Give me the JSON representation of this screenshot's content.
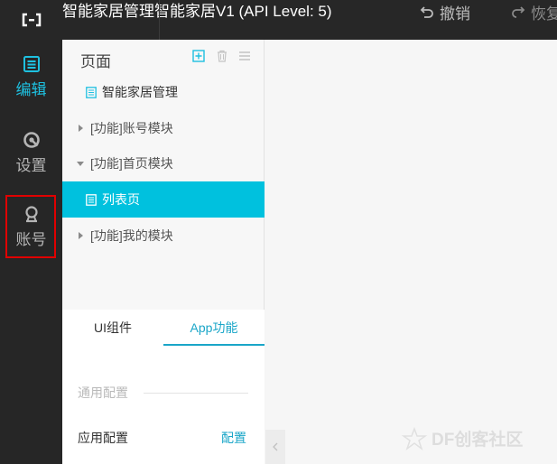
{
  "header": {
    "title": "智能家居管理智能家居V1 (API Level: 5)",
    "undo_label": "撤销",
    "redo_label": "恢复"
  },
  "rail": {
    "items": [
      {
        "label": "编辑",
        "icon": "edit-icon",
        "active": true
      },
      {
        "label": "设置",
        "icon": "settings-icon",
        "active": false
      },
      {
        "label": "账号",
        "icon": "account-icon",
        "active": false
      }
    ]
  },
  "panel": {
    "title": "页面",
    "tree": [
      {
        "label": "智能家居管理",
        "type": "page"
      },
      {
        "label": "[功能]账号模块",
        "type": "folder-collapsed"
      },
      {
        "label": "[功能]首页模块",
        "type": "folder-expanded"
      },
      {
        "label": "列表页",
        "type": "page",
        "selected": true
      },
      {
        "label": "[功能]我的模块",
        "type": "folder-collapsed"
      }
    ],
    "tabs": [
      {
        "label": "UI组件",
        "active": false
      },
      {
        "label": "App功能",
        "active": true
      }
    ],
    "section_label": "通用配置",
    "config_label": "应用配置",
    "config_link": "配置"
  },
  "canvas": {
    "watermark": "DF创客社区"
  },
  "colors": {
    "accent": "#00c1de",
    "highlight": "#e00000",
    "topbar": "#272727",
    "rail": "#262626"
  }
}
